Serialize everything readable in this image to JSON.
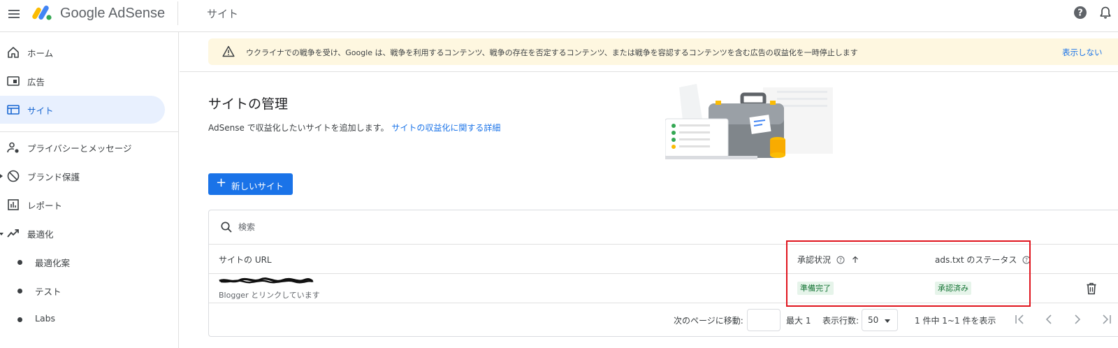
{
  "app": {
    "brand": "Google AdSense",
    "page_heading": "サイト",
    "icons": {
      "menu": "menu-icon",
      "help": "help-circle-icon",
      "notifications": "bell-icon"
    },
    "brand_colors": [
      "#fbbc04",
      "#4285f4",
      "#34a853"
    ]
  },
  "sidebar": {
    "items": [
      {
        "label": "ホーム",
        "icon": "home-icon"
      },
      {
        "label": "広告",
        "icon": "ad-unit-icon"
      },
      {
        "label": "サイト",
        "icon": "web-icon",
        "active": true
      },
      {
        "label": "プライバシーとメッセージ",
        "icon": "privacy-person-icon"
      },
      {
        "label": "ブランド保護",
        "icon": "block-icon",
        "collapsed": true
      },
      {
        "label": "レポート",
        "icon": "bar-chart-icon"
      },
      {
        "label": "最適化",
        "icon": "trending-up-icon",
        "expanded": true
      },
      {
        "label": "最適化案",
        "icon": "bullet-icon",
        "sub": true
      },
      {
        "label": "テスト",
        "icon": "bullet-icon",
        "sub": true
      },
      {
        "label": "Labs",
        "icon": "bullet-icon",
        "sub": true
      }
    ],
    "accent_color": "#1967d2",
    "active_bg": "#e8f0fe"
  },
  "banner": {
    "text": "ウクライナでの戦争を受け、Google は、戦争を利用するコンテンツ、戦争の存在を否定するコンテンツ、または戦争を容認するコンテンツを含む広告の収益化を一時停止します",
    "dismiss_label": "表示しない",
    "icon": "warning-icon",
    "bg_color": "#fef7e0"
  },
  "main": {
    "title": "サイトの管理",
    "description": "AdSense で収益化したいサイトを追加します。",
    "learn_more_link": "サイトの収益化に関する詳細",
    "new_site_button": "新しいサイト",
    "button_color": "#1a73e8"
  },
  "table": {
    "search_placeholder": "検索",
    "columns": {
      "url": "サイトの URL",
      "approval": "承認状況",
      "ads_txt": "ads.txt のステータス"
    },
    "rows": [
      {
        "url_redacted": true,
        "subtitle": "Blogger とリンクしています",
        "approval_status": "準備完了",
        "ads_txt_status": "承認済み"
      }
    ],
    "status_chip_color": "#137333"
  },
  "pager": {
    "goto_label": "次のページに移動:",
    "goto_value": "",
    "max_label": "最大 1",
    "rows_label": "表示行数:",
    "rows_value": "50",
    "range_label": "1 件中 1~1 件を表示"
  },
  "highlight_color": "#e0141d"
}
